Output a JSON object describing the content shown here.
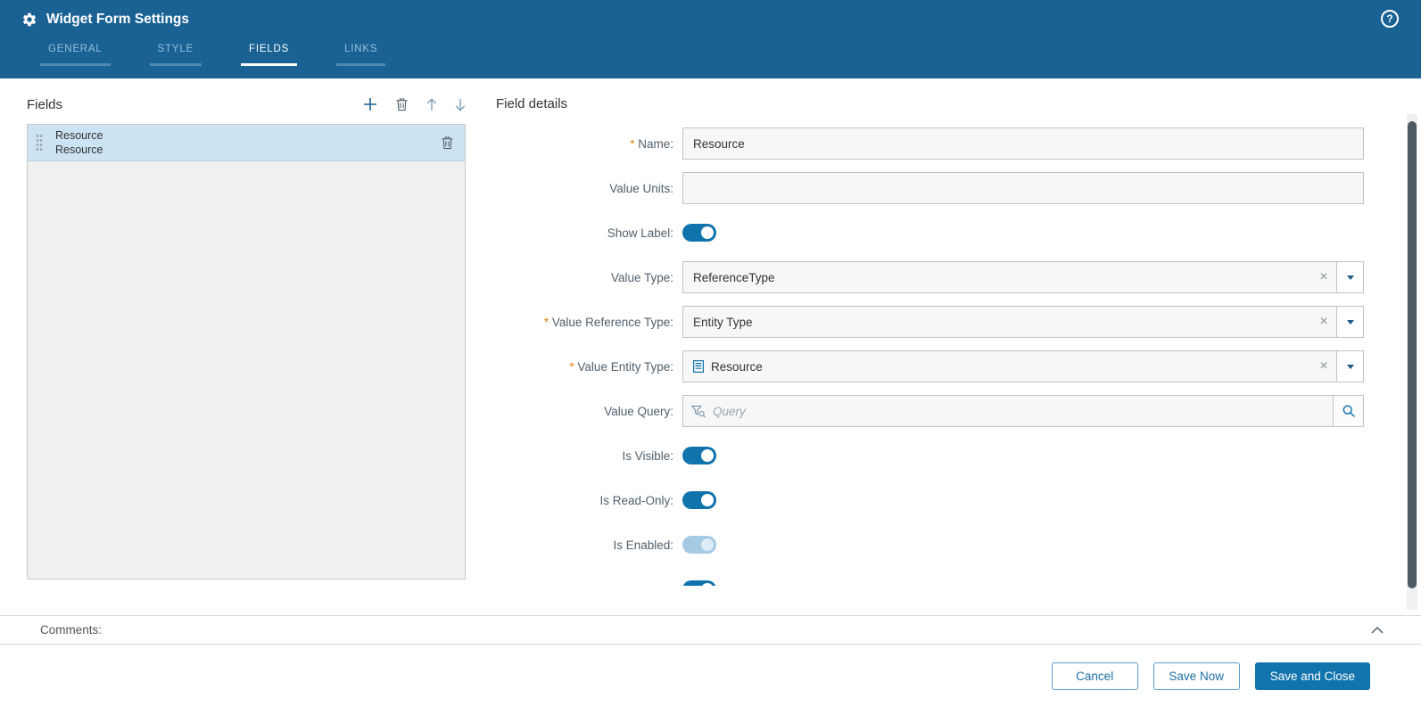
{
  "colors": {
    "header_bg": "#1a6294",
    "accent_blue": "#1274ac",
    "tab_inactive_text": "#96bed9",
    "selected_row_bg": "#cce3f3",
    "required_marker": "#e8820e",
    "toggle_on": "#1173ac",
    "toggle_disabled": "#a5cbe4",
    "scrollbar_thumb": "#4d5a64"
  },
  "header": {
    "title": "Widget Form Settings",
    "app_icon": "gear-icon",
    "help_symbol": "?",
    "tabs": [
      {
        "label": "GENERAL",
        "active": false
      },
      {
        "label": "STYLE",
        "active": false
      },
      {
        "label": "FIELDS",
        "active": true
      },
      {
        "label": "LINKS",
        "active": false
      }
    ]
  },
  "fields_panel": {
    "title": "Fields",
    "toolbar": [
      {
        "icon": "add-icon"
      },
      {
        "icon": "delete-icon"
      },
      {
        "icon": "move-up-icon"
      },
      {
        "icon": "move-down-icon"
      }
    ],
    "items": [
      {
        "line1": "Resource",
        "line2": "Resource",
        "selected": true
      }
    ]
  },
  "field_details": {
    "title": "Field details",
    "rows": [
      {
        "label": "Name:",
        "required": true,
        "type": "text",
        "value": "Resource"
      },
      {
        "label": "Value Units:",
        "required": false,
        "type": "text",
        "value": ""
      },
      {
        "label": "Show Label:",
        "required": false,
        "type": "toggle",
        "on": true,
        "disabled": false
      },
      {
        "label": "Value Type:",
        "required": false,
        "type": "combo",
        "value": "ReferenceType",
        "icon": null
      },
      {
        "label": "Value Reference Type:",
        "required": true,
        "type": "combo",
        "value": "Entity Type",
        "icon": null
      },
      {
        "label": "Value Entity Type:",
        "required": true,
        "type": "combo",
        "value": "Resource",
        "icon": "entity-type-icon"
      },
      {
        "label": "Value Query:",
        "required": false,
        "type": "query",
        "placeholder": "Query"
      },
      {
        "label": "Is Visible:",
        "required": false,
        "type": "toggle",
        "on": true,
        "disabled": false
      },
      {
        "label": "Is Read-Only:",
        "required": false,
        "type": "toggle",
        "on": true,
        "disabled": false
      },
      {
        "label": "Is Enabled:",
        "required": false,
        "type": "toggle",
        "on": true,
        "disabled": true
      },
      {
        "label": "",
        "required": false,
        "type": "toggle",
        "on": true,
        "disabled": false,
        "partially_visible": true
      }
    ]
  },
  "comments": {
    "label": "Comments:",
    "collapse_icon": "chevron-up-icon"
  },
  "footer": {
    "buttons": [
      {
        "label": "Cancel",
        "style": "outline"
      },
      {
        "label": "Save Now",
        "style": "outline"
      },
      {
        "label": "Save and Close",
        "style": "primary"
      }
    ]
  }
}
